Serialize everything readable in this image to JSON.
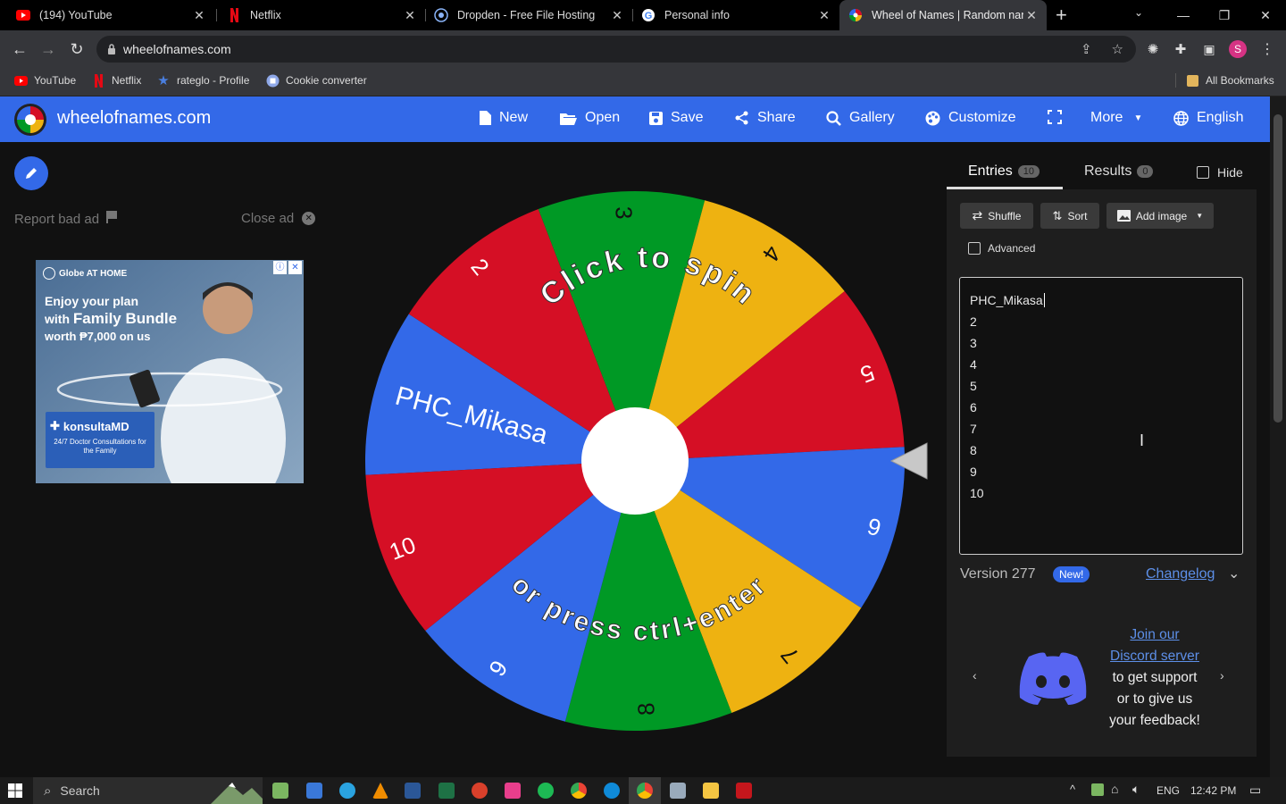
{
  "browser": {
    "tabs": [
      {
        "title": "(194) YouTube",
        "icon": "youtube-icon",
        "color": "#ff0000"
      },
      {
        "title": "Netflix",
        "icon": "netflix-icon",
        "color": "#e50914"
      },
      {
        "title": "Dropden - Free File Hosting",
        "icon": "dropden-icon",
        "color": "#8ab4f8"
      },
      {
        "title": "Personal info",
        "icon": "google-icon",
        "color": "#4285f4"
      },
      {
        "title": "Wheel of Names | Random nan",
        "icon": "wheel-icon",
        "color": "#3369e8"
      }
    ],
    "new_tab": "+",
    "url": "wheelofnames.com",
    "bookmarks": [
      {
        "label": "YouTube",
        "icon": "youtube-icon"
      },
      {
        "label": "Netflix",
        "icon": "netflix-icon"
      },
      {
        "label": "rateglo - Profile",
        "icon": "star-icon"
      },
      {
        "label": "Cookie converter",
        "icon": "extension-icon"
      }
    ],
    "all_bookmarks": "All Bookmarks",
    "profile_initial": "S"
  },
  "site": {
    "name": "wheelofnames.com",
    "menu": {
      "new": "New",
      "open": "Open",
      "save": "Save",
      "share": "Share",
      "gallery": "Gallery",
      "customize": "Customize",
      "more": "More",
      "language": "English"
    },
    "accent": "#3369e8"
  },
  "ad": {
    "report": "Report bad ad",
    "close": "Close ad",
    "brand": "Globe AT HOME",
    "line1": "Enjoy your plan",
    "line2a": "with ",
    "line2b": "Family Bundle",
    "line3": "worth ₱7,000 on us",
    "partner": "konsultaMD",
    "partner_sub": "24/7 Doctor Consultations for the Family"
  },
  "wheel": {
    "top_text": "Click to spin",
    "bottom_text": "or press ctrl+enter",
    "segments": [
      "PHC_Mikasa",
      "2",
      "3",
      "4",
      "5",
      "6",
      "7",
      "8",
      "9",
      "10"
    ],
    "colors": [
      "#3369e8",
      "#d50f25",
      "#eeb211",
      "#009925"
    ]
  },
  "panel": {
    "entries_tab": "Entries",
    "entries_count": "10",
    "results_tab": "Results",
    "results_count": "0",
    "hide": "Hide",
    "shuffle": "Shuffle",
    "sort": "Sort",
    "add_image": "Add image",
    "advanced": "Advanced",
    "entries": [
      "PHC_Mikasa",
      "2",
      "3",
      "4",
      "5",
      "6",
      "7",
      "8",
      "9",
      "10"
    ],
    "version": "Version 277",
    "new_badge": "New!",
    "changelog": "Changelog",
    "discord_link1": "Join our",
    "discord_link2": "Discord server",
    "discord_text1": "to get support",
    "discord_text2": "or to give us",
    "discord_text3": "your feedback!"
  },
  "taskbar": {
    "search": "Search",
    "lang": "ENG",
    "time": "12:42 PM"
  }
}
